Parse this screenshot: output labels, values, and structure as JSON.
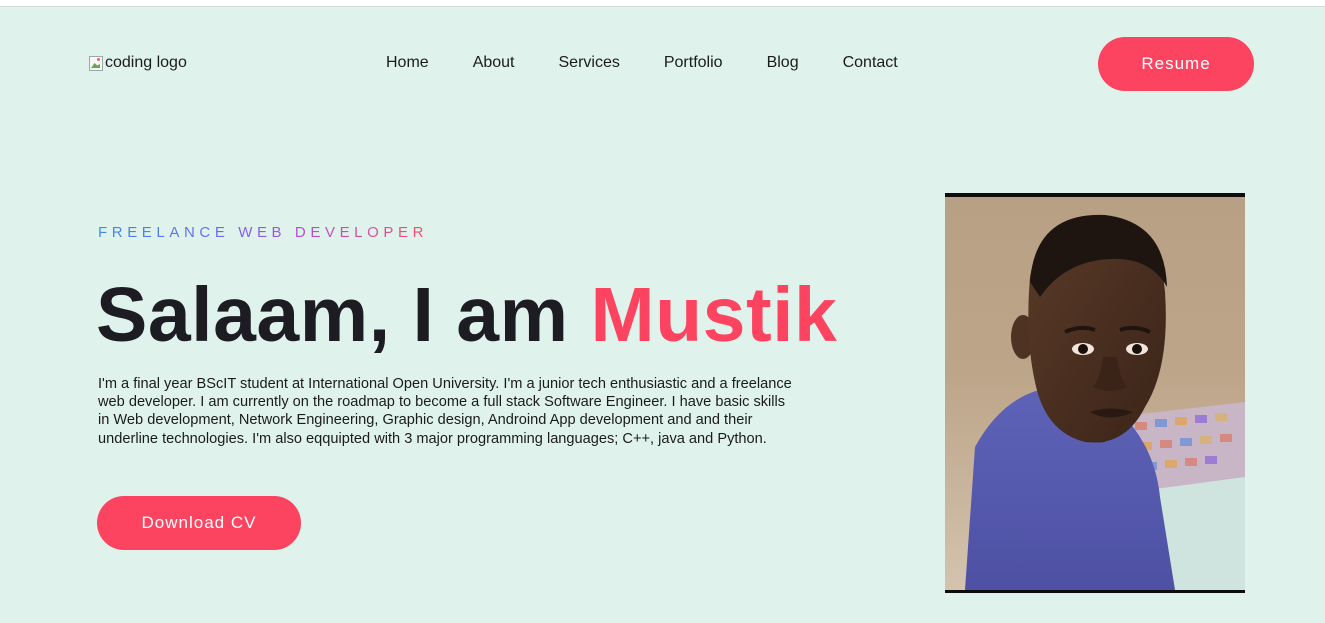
{
  "header": {
    "logo_alt": "coding logo",
    "nav": [
      "Home",
      "About",
      "Services",
      "Portfolio",
      "Blog",
      "Contact"
    ],
    "resume_label": "Resume"
  },
  "hero": {
    "eyebrow": "FREELANCE WEB DEVELOPER",
    "headline_prefix": "Salaam, I am ",
    "headline_name": "Mustik",
    "bio": "I'm a final year BScIT student at International Open University. I'm a junior tech enthusiastic and a freelance web developer. I am currently on the roadmap to become a full stack Software Engineer. I have basic skills in Web development, Network Engineering, Graphic design, Androind App development and and their underline technologies. I'm also eqquipted with 3 major programming languages; C++, java and Python.",
    "cta_label": "Download CV"
  },
  "portrait": {
    "icon": "person-photo"
  },
  "colors": {
    "background": "#dff3ec",
    "accent": "#fc4460",
    "text": "#1c1c22"
  }
}
